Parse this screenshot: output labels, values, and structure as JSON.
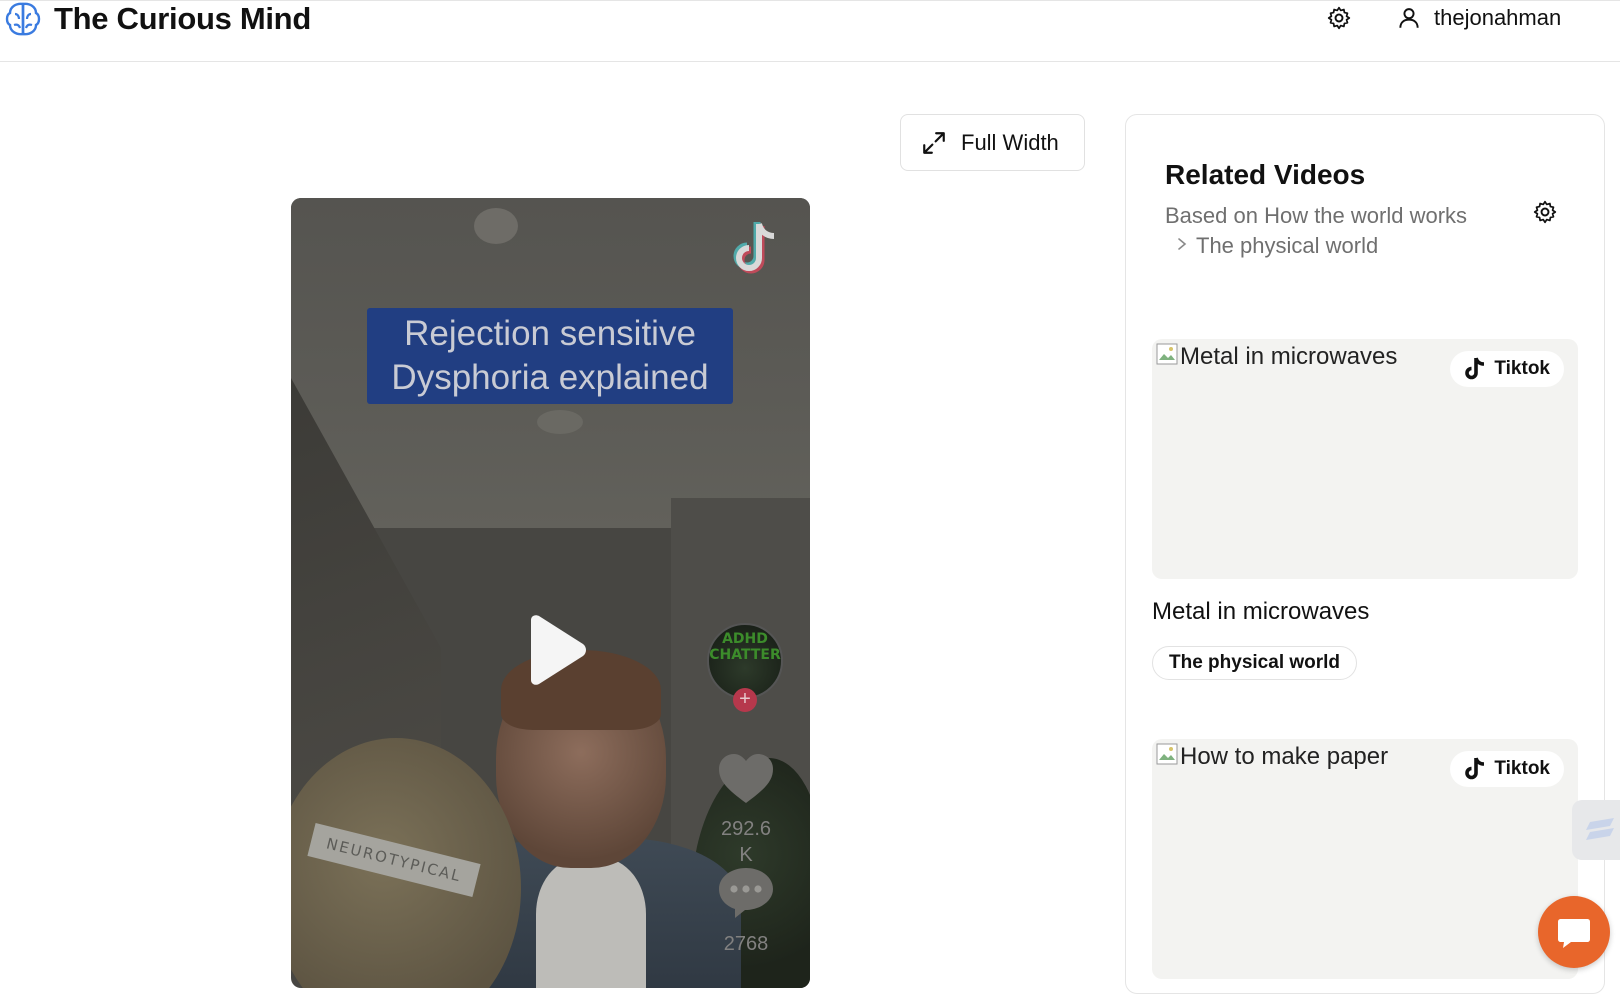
{
  "header": {
    "app_title": "The Curious Mind",
    "username": "thejonahman",
    "icons": [
      "brain-logo-icon",
      "gear-icon",
      "user-icon"
    ]
  },
  "toolbar": {
    "full_width_label": "Full Width"
  },
  "video": {
    "caption_line1": "Rejection sensitive",
    "caption_line2": "Dysphoria explained",
    "ball_label": "NEUROTYPICAL",
    "avatar_text_line1": "ADHD",
    "avatar_text_line2": "CHATTER",
    "like_count_line1": "292.6",
    "like_count_line2": "K",
    "comment_count": "2768"
  },
  "related": {
    "title": "Related Videos",
    "based_on": "Based on How the world works",
    "subcategory": "The physical world",
    "items": [
      {
        "alt": "Metal in microwaves",
        "badge": "Tiktok",
        "title": "Metal in microwaves",
        "tag": "The physical world"
      },
      {
        "alt": "How to make paper",
        "badge": "Tiktok"
      }
    ]
  },
  "colors": {
    "accent_blue": "#3a7be0",
    "caption_bg": "#213e82",
    "chat_orange": "#e8662b"
  }
}
